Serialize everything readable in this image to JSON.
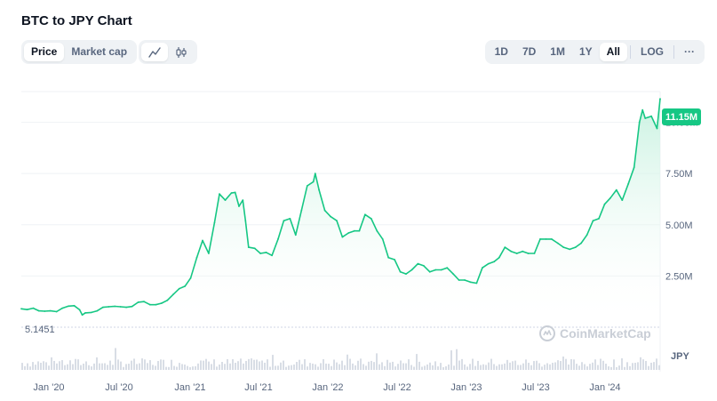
{
  "header": {
    "title": "BTC to JPY Chart"
  },
  "toggles": {
    "price_label": "Price",
    "market_cap_label": "Market cap",
    "line_icon": "line-chart-icon",
    "candle_icon": "candlestick-icon"
  },
  "ranges": [
    "1D",
    "7D",
    "1M",
    "1Y",
    "All",
    "LOG"
  ],
  "active_range": "All",
  "more_label": "···",
  "colors": {
    "line": "#16c784",
    "area_top": "#c6f1df",
    "badge": "#16c784",
    "volume": "#d8dde5",
    "grid": "#eff2f5"
  },
  "watermark": "CoinMarketCap",
  "currency": "JPY",
  "chart_data": {
    "type": "area",
    "title": "BTC to JPY Chart",
    "y_ticks": [
      "2.50M",
      "5.00M",
      "7.50M",
      "10.00M"
    ],
    "y_tick_values": [
      2500000,
      5000000,
      7500000,
      10000000
    ],
    "x_ticks": [
      "Jan '20",
      "Jul '20",
      "Jan '21",
      "Jul '21",
      "Jan '22",
      "Jul '22",
      "Jan '23",
      "Jul '23",
      "Jan '24"
    ],
    "ylim": [
      0,
      11500000
    ],
    "current_price_label": "11.15M",
    "baseline_label": "5.1451",
    "grid": true,
    "x": [
      "2019-10-05",
      "2019-10-20",
      "2019-11-05",
      "2019-11-20",
      "2019-12-05",
      "2019-12-20",
      "2020-01-05",
      "2020-01-20",
      "2020-02-05",
      "2020-02-20",
      "2020-03-05",
      "2020-03-12",
      "2020-03-20",
      "2020-04-05",
      "2020-04-20",
      "2020-05-05",
      "2020-05-20",
      "2020-06-05",
      "2020-06-20",
      "2020-07-05",
      "2020-07-20",
      "2020-08-05",
      "2020-08-20",
      "2020-09-05",
      "2020-09-20",
      "2020-10-05",
      "2020-10-20",
      "2020-11-05",
      "2020-11-20",
      "2020-12-05",
      "2020-12-20",
      "2021-01-05",
      "2021-01-20",
      "2021-02-05",
      "2021-02-20",
      "2021-03-05",
      "2021-03-20",
      "2021-04-05",
      "2021-04-15",
      "2021-04-25",
      "2021-05-05",
      "2021-05-12",
      "2021-05-20",
      "2021-06-05",
      "2021-06-20",
      "2021-07-05",
      "2021-07-20",
      "2021-08-05",
      "2021-08-20",
      "2021-09-05",
      "2021-09-20",
      "2021-10-05",
      "2021-10-20",
      "2021-11-05",
      "2021-11-10",
      "2021-11-20",
      "2021-12-05",
      "2021-12-20",
      "2022-01-05",
      "2022-01-20",
      "2022-02-05",
      "2022-02-20",
      "2022-03-05",
      "2022-03-20",
      "2022-04-05",
      "2022-04-20",
      "2022-05-05",
      "2022-05-20",
      "2022-06-05",
      "2022-06-20",
      "2022-07-05",
      "2022-07-20",
      "2022-08-05",
      "2022-08-20",
      "2022-09-05",
      "2022-09-20",
      "2022-10-05",
      "2022-10-20",
      "2022-11-05",
      "2022-11-20",
      "2022-12-05",
      "2022-12-20",
      "2023-01-05",
      "2023-01-20",
      "2023-02-05",
      "2023-02-20",
      "2023-03-05",
      "2023-03-20",
      "2023-04-05",
      "2023-04-20",
      "2023-05-05",
      "2023-05-20",
      "2023-06-05",
      "2023-06-20",
      "2023-07-05",
      "2023-07-20",
      "2023-08-05",
      "2023-08-20",
      "2023-09-05",
      "2023-09-20",
      "2023-10-05",
      "2023-10-20",
      "2023-11-05",
      "2023-11-20",
      "2023-12-05",
      "2023-12-20",
      "2024-01-05",
      "2024-01-20",
      "2024-02-05",
      "2024-02-20",
      "2024-03-05",
      "2024-03-13",
      "2024-03-20",
      "2024-04-05",
      "2024-04-20",
      "2024-04-28"
    ],
    "y": [
      900000,
      860000,
      930000,
      800000,
      780000,
      800000,
      760000,
      930000,
      1030000,
      1050000,
      850000,
      600000,
      700000,
      720000,
      800000,
      970000,
      1000000,
      1020000,
      1000000,
      970000,
      1010000,
      1220000,
      1250000,
      1100000,
      1100000,
      1170000,
      1310000,
      1610000,
      1880000,
      2000000,
      2400000,
      3400000,
      4230000,
      3600000,
      5100000,
      6500000,
      6200000,
      6550000,
      6580000,
      5900000,
      6200000,
      5200000,
      3900000,
      3850000,
      3600000,
      3650000,
      3500000,
      4300000,
      5200000,
      5300000,
      4500000,
      5700000,
      6900000,
      7100000,
      7500000,
      6700000,
      5700000,
      5400000,
      5200000,
      4400000,
      4600000,
      4700000,
      4700000,
      5500000,
      5300000,
      4700000,
      4300000,
      3400000,
      3300000,
      2700000,
      2600000,
      2800000,
      3100000,
      3000000,
      2700000,
      2800000,
      2800000,
      2900000,
      2600000,
      2300000,
      2300000,
      2200000,
      2150000,
      2900000,
      3100000,
      3200000,
      3400000,
      3900000,
      3700000,
      3600000,
      3700000,
      3600000,
      3600000,
      4300000,
      4300000,
      4300000,
      4100000,
      3900000,
      3800000,
      3900000,
      4100000,
      4500000,
      5200000,
      5300000,
      6000000,
      6300000,
      6700000,
      6200000,
      7000000,
      7800000,
      10000000,
      10600000,
      10200000,
      10300000,
      9700000,
      11150000
    ]
  }
}
